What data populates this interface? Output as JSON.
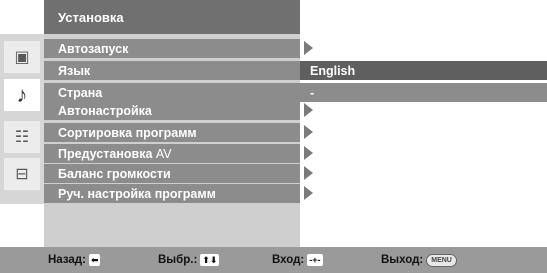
{
  "header": {
    "title": "Установка"
  },
  "sidebar": {
    "icons": [
      {
        "name": "picture-icon",
        "glyph": "▣",
        "active": false
      },
      {
        "name": "music-note-icon",
        "glyph": "♪",
        "active": true
      },
      {
        "name": "channel-list-icon",
        "glyph": "☷",
        "active": false
      },
      {
        "name": "toolbox-icon",
        "glyph": "⊟",
        "active": false
      }
    ]
  },
  "menu": {
    "items": [
      {
        "label": "Автозапуск",
        "suffix": "",
        "has_arrow": true
      },
      {
        "label": "Язык",
        "suffix": "",
        "has_arrow": false
      },
      {
        "label": "Страна",
        "suffix": "",
        "has_arrow": false
      },
      {
        "label": "Автонастройка",
        "suffix": "",
        "has_arrow": true
      },
      {
        "label": "Сортировка программ",
        "suffix": "",
        "has_arrow": true
      },
      {
        "label": "Предустановка",
        "suffix": "AV",
        "has_arrow": true
      },
      {
        "label": "Баланс громкости",
        "suffix": "",
        "has_arrow": true
      },
      {
        "label": "Руч. настройка программ",
        "suffix": "",
        "has_arrow": true
      }
    ]
  },
  "submenu": {
    "language_value": "English",
    "country_value": "-"
  },
  "footer": {
    "back_label": "Назад:",
    "back_glyph": "⬅",
    "select_label": "Выбр.:",
    "select_glyph": "⬆⬇",
    "enter_label": "Вход:",
    "enter_glyph": "-+-",
    "exit_label": "Выход:",
    "exit_glyph": "MENU"
  }
}
